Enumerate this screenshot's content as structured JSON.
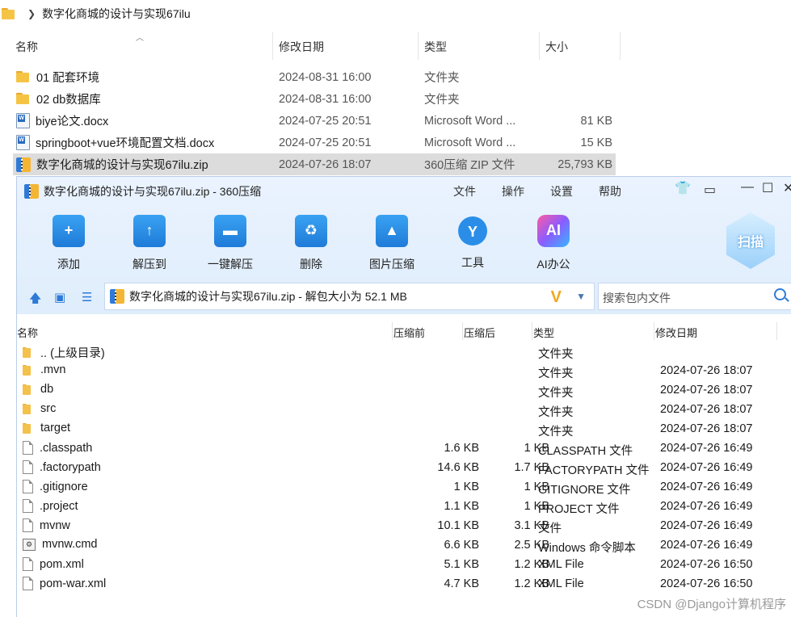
{
  "explorer": {
    "breadcrumb": "数字化商城的设计与实现67ilu",
    "columns": {
      "name": "名称",
      "modified": "修改日期",
      "type": "类型",
      "size": "大小"
    },
    "rows": [
      {
        "name": "01 配套环境",
        "date": "2024-08-31 16:00",
        "type": "文件夹",
        "size": "",
        "icon": "folder-icon"
      },
      {
        "name": "02 db数据库",
        "date": "2024-08-31 16:00",
        "type": "文件夹",
        "size": "",
        "icon": "folder-icon"
      },
      {
        "name": "biye论文.docx",
        "date": "2024-07-25 20:51",
        "type": "Microsoft Word ...",
        "size": "81 KB",
        "icon": "word-doc-icon"
      },
      {
        "name": "springboot+vue环境配置文档.docx",
        "date": "2024-07-25 20:51",
        "type": "Microsoft Word ...",
        "size": "15 KB",
        "icon": "word-doc-icon"
      },
      {
        "name": "数字化商城的设计与实现67ilu.zip",
        "date": "2024-07-26 18:07",
        "type": "360压缩 ZIP 文件",
        "size": "25,793 KB",
        "icon": "zip-icon",
        "selected": true
      }
    ]
  },
  "zipwin": {
    "title": "数字化商城的设计与实现67ilu.zip - 360压缩",
    "menu": [
      "文件",
      "操作",
      "设置",
      "帮助"
    ],
    "toolbar": [
      {
        "label": "添加",
        "icon": "add-icon",
        "glyph": "+"
      },
      {
        "label": "解压到",
        "icon": "extract-to-icon",
        "glyph": "↑"
      },
      {
        "label": "一键解压",
        "icon": "one-click-extract-icon",
        "glyph": "▬"
      },
      {
        "label": "删除",
        "icon": "delete-icon",
        "glyph": "♻"
      },
      {
        "label": "图片压缩",
        "icon": "image-compress-icon",
        "glyph": "▲"
      },
      {
        "label": "工具",
        "icon": "tools-icon",
        "glyph": "Y"
      },
      {
        "label": "AI办公",
        "icon": "ai-office-icon",
        "glyph": "AI"
      }
    ],
    "scan_label": "扫描",
    "address": "数字化商城的设计与实现67ilu.zip - 解包大小为 52.1 MB",
    "search_placeholder": "搜索包内文件",
    "columns": {
      "name": "名称",
      "before": "压缩前",
      "after": "压缩后",
      "type": "类型",
      "date": "修改日期"
    },
    "rows": [
      {
        "name": ".. (上级目录)",
        "before": "",
        "after": "",
        "type": "文件夹",
        "date": "",
        "icon": "folder-icon"
      },
      {
        "name": ".mvn",
        "before": "",
        "after": "",
        "type": "文件夹",
        "date": "2024-07-26 18:07",
        "icon": "folder-icon"
      },
      {
        "name": "db",
        "before": "",
        "after": "",
        "type": "文件夹",
        "date": "2024-07-26 18:07",
        "icon": "folder-icon"
      },
      {
        "name": "src",
        "before": "",
        "after": "",
        "type": "文件夹",
        "date": "2024-07-26 18:07",
        "icon": "folder-icon"
      },
      {
        "name": "target",
        "before": "",
        "after": "",
        "type": "文件夹",
        "date": "2024-07-26 18:07",
        "icon": "folder-icon"
      },
      {
        "name": ".classpath",
        "before": "1.6 KB",
        "after": "1 KB",
        "type": "CLASSPATH 文件",
        "date": "2024-07-26 16:49",
        "icon": "file-icon"
      },
      {
        "name": ".factorypath",
        "before": "14.6 KB",
        "after": "1.7 KB",
        "type": "FACTORYPATH 文件",
        "date": "2024-07-26 16:49",
        "icon": "file-icon"
      },
      {
        "name": ".gitignore",
        "before": "1 KB",
        "after": "1 KB",
        "type": "GITIGNORE 文件",
        "date": "2024-07-26 16:49",
        "icon": "file-icon"
      },
      {
        "name": ".project",
        "before": "1.1 KB",
        "after": "1 KB",
        "type": "PROJECT 文件",
        "date": "2024-07-26 16:49",
        "icon": "file-icon"
      },
      {
        "name": "mvnw",
        "before": "10.1 KB",
        "after": "3.1 KB",
        "type": "文件",
        "date": "2024-07-26 16:49",
        "icon": "file-icon"
      },
      {
        "name": "mvnw.cmd",
        "before": "6.6 KB",
        "after": "2.5 KB",
        "type": "Windows 命令脚本",
        "date": "2024-07-26 16:49",
        "icon": "cmd-script-icon"
      },
      {
        "name": "pom.xml",
        "before": "5.1 KB",
        "after": "1.2 KB",
        "type": "XML File",
        "date": "2024-07-26 16:50",
        "icon": "file-icon"
      },
      {
        "name": "pom-war.xml",
        "before": "4.7 KB",
        "after": "1.2 KB",
        "type": "XML File",
        "date": "2024-07-26 16:50",
        "icon": "file-icon"
      }
    ]
  },
  "watermark": "CSDN @Django计算机程序"
}
